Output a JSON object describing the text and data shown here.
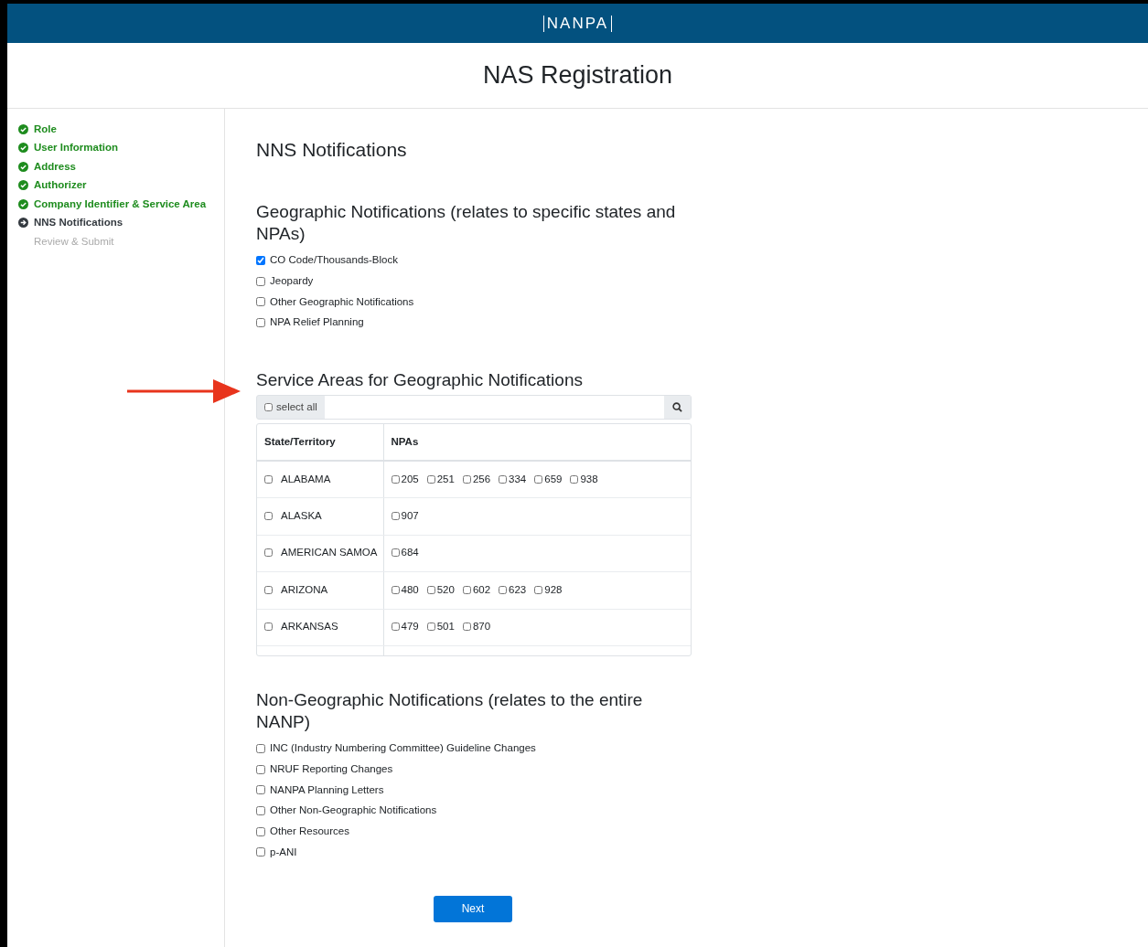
{
  "brand": "NANPA",
  "page_title": "NAS Registration",
  "steps": [
    {
      "label": "Role",
      "completed": true,
      "current": false
    },
    {
      "label": "User Information",
      "completed": true,
      "current": false
    },
    {
      "label": "Address",
      "completed": true,
      "current": false
    },
    {
      "label": "Authorizer",
      "completed": true,
      "current": false
    },
    {
      "label": "Company Identifier & Service Area",
      "completed": true,
      "current": false
    },
    {
      "label": "NNS Notifications",
      "completed": false,
      "current": true
    },
    {
      "label": "Review & Submit",
      "completed": false,
      "current": false
    }
  ],
  "section_title": "NNS Notifications",
  "geographic": {
    "title": "Geographic Notifications (relates to specific states and NPAs)",
    "options": [
      {
        "label": "CO Code/Thousands-Block",
        "checked": true
      },
      {
        "label": "Jeopardy",
        "checked": false
      },
      {
        "label": "Other Geographic Notifications",
        "checked": false
      },
      {
        "label": "NPA Relief Planning",
        "checked": false
      }
    ]
  },
  "service_areas": {
    "title": "Service Areas for Geographic Notifications",
    "select_all": {
      "label": "select all",
      "checked": false
    },
    "columns": [
      "State/Territory",
      "NPAs"
    ],
    "rows": [
      {
        "state": "ALABAMA",
        "checked": false,
        "npas": [
          {
            "code": "205",
            "checked": false
          },
          {
            "code": "251",
            "checked": false
          },
          {
            "code": "256",
            "checked": false
          },
          {
            "code": "334",
            "checked": false
          },
          {
            "code": "659",
            "checked": false
          },
          {
            "code": "938",
            "checked": false
          }
        ]
      },
      {
        "state": "ALASKA",
        "checked": false,
        "npas": [
          {
            "code": "907",
            "checked": false
          }
        ]
      },
      {
        "state": "AMERICAN SAMOA",
        "checked": false,
        "npas": [
          {
            "code": "684",
            "checked": false
          }
        ]
      },
      {
        "state": "ARIZONA",
        "checked": false,
        "npas": [
          {
            "code": "480",
            "checked": false
          },
          {
            "code": "520",
            "checked": false
          },
          {
            "code": "602",
            "checked": false
          },
          {
            "code": "623",
            "checked": false
          },
          {
            "code": "928",
            "checked": false
          }
        ]
      },
      {
        "state": "ARKANSAS",
        "checked": false,
        "npas": [
          {
            "code": "479",
            "checked": false
          },
          {
            "code": "501",
            "checked": false
          },
          {
            "code": "870",
            "checked": false
          }
        ]
      }
    ]
  },
  "non_geographic": {
    "title": "Non-Geographic Notifications (relates to the entire NANP)",
    "options": [
      {
        "label": "INC (Industry Numbering Committee) Guideline Changes",
        "checked": false
      },
      {
        "label": "NRUF Reporting Changes",
        "checked": false
      },
      {
        "label": "NANPA Planning Letters",
        "checked": false
      },
      {
        "label": "Other Non-Geographic Notifications",
        "checked": false
      },
      {
        "label": "Other Resources",
        "checked": false
      },
      {
        "label": "p-ANI",
        "checked": false
      }
    ]
  },
  "next_button": "Next"
}
